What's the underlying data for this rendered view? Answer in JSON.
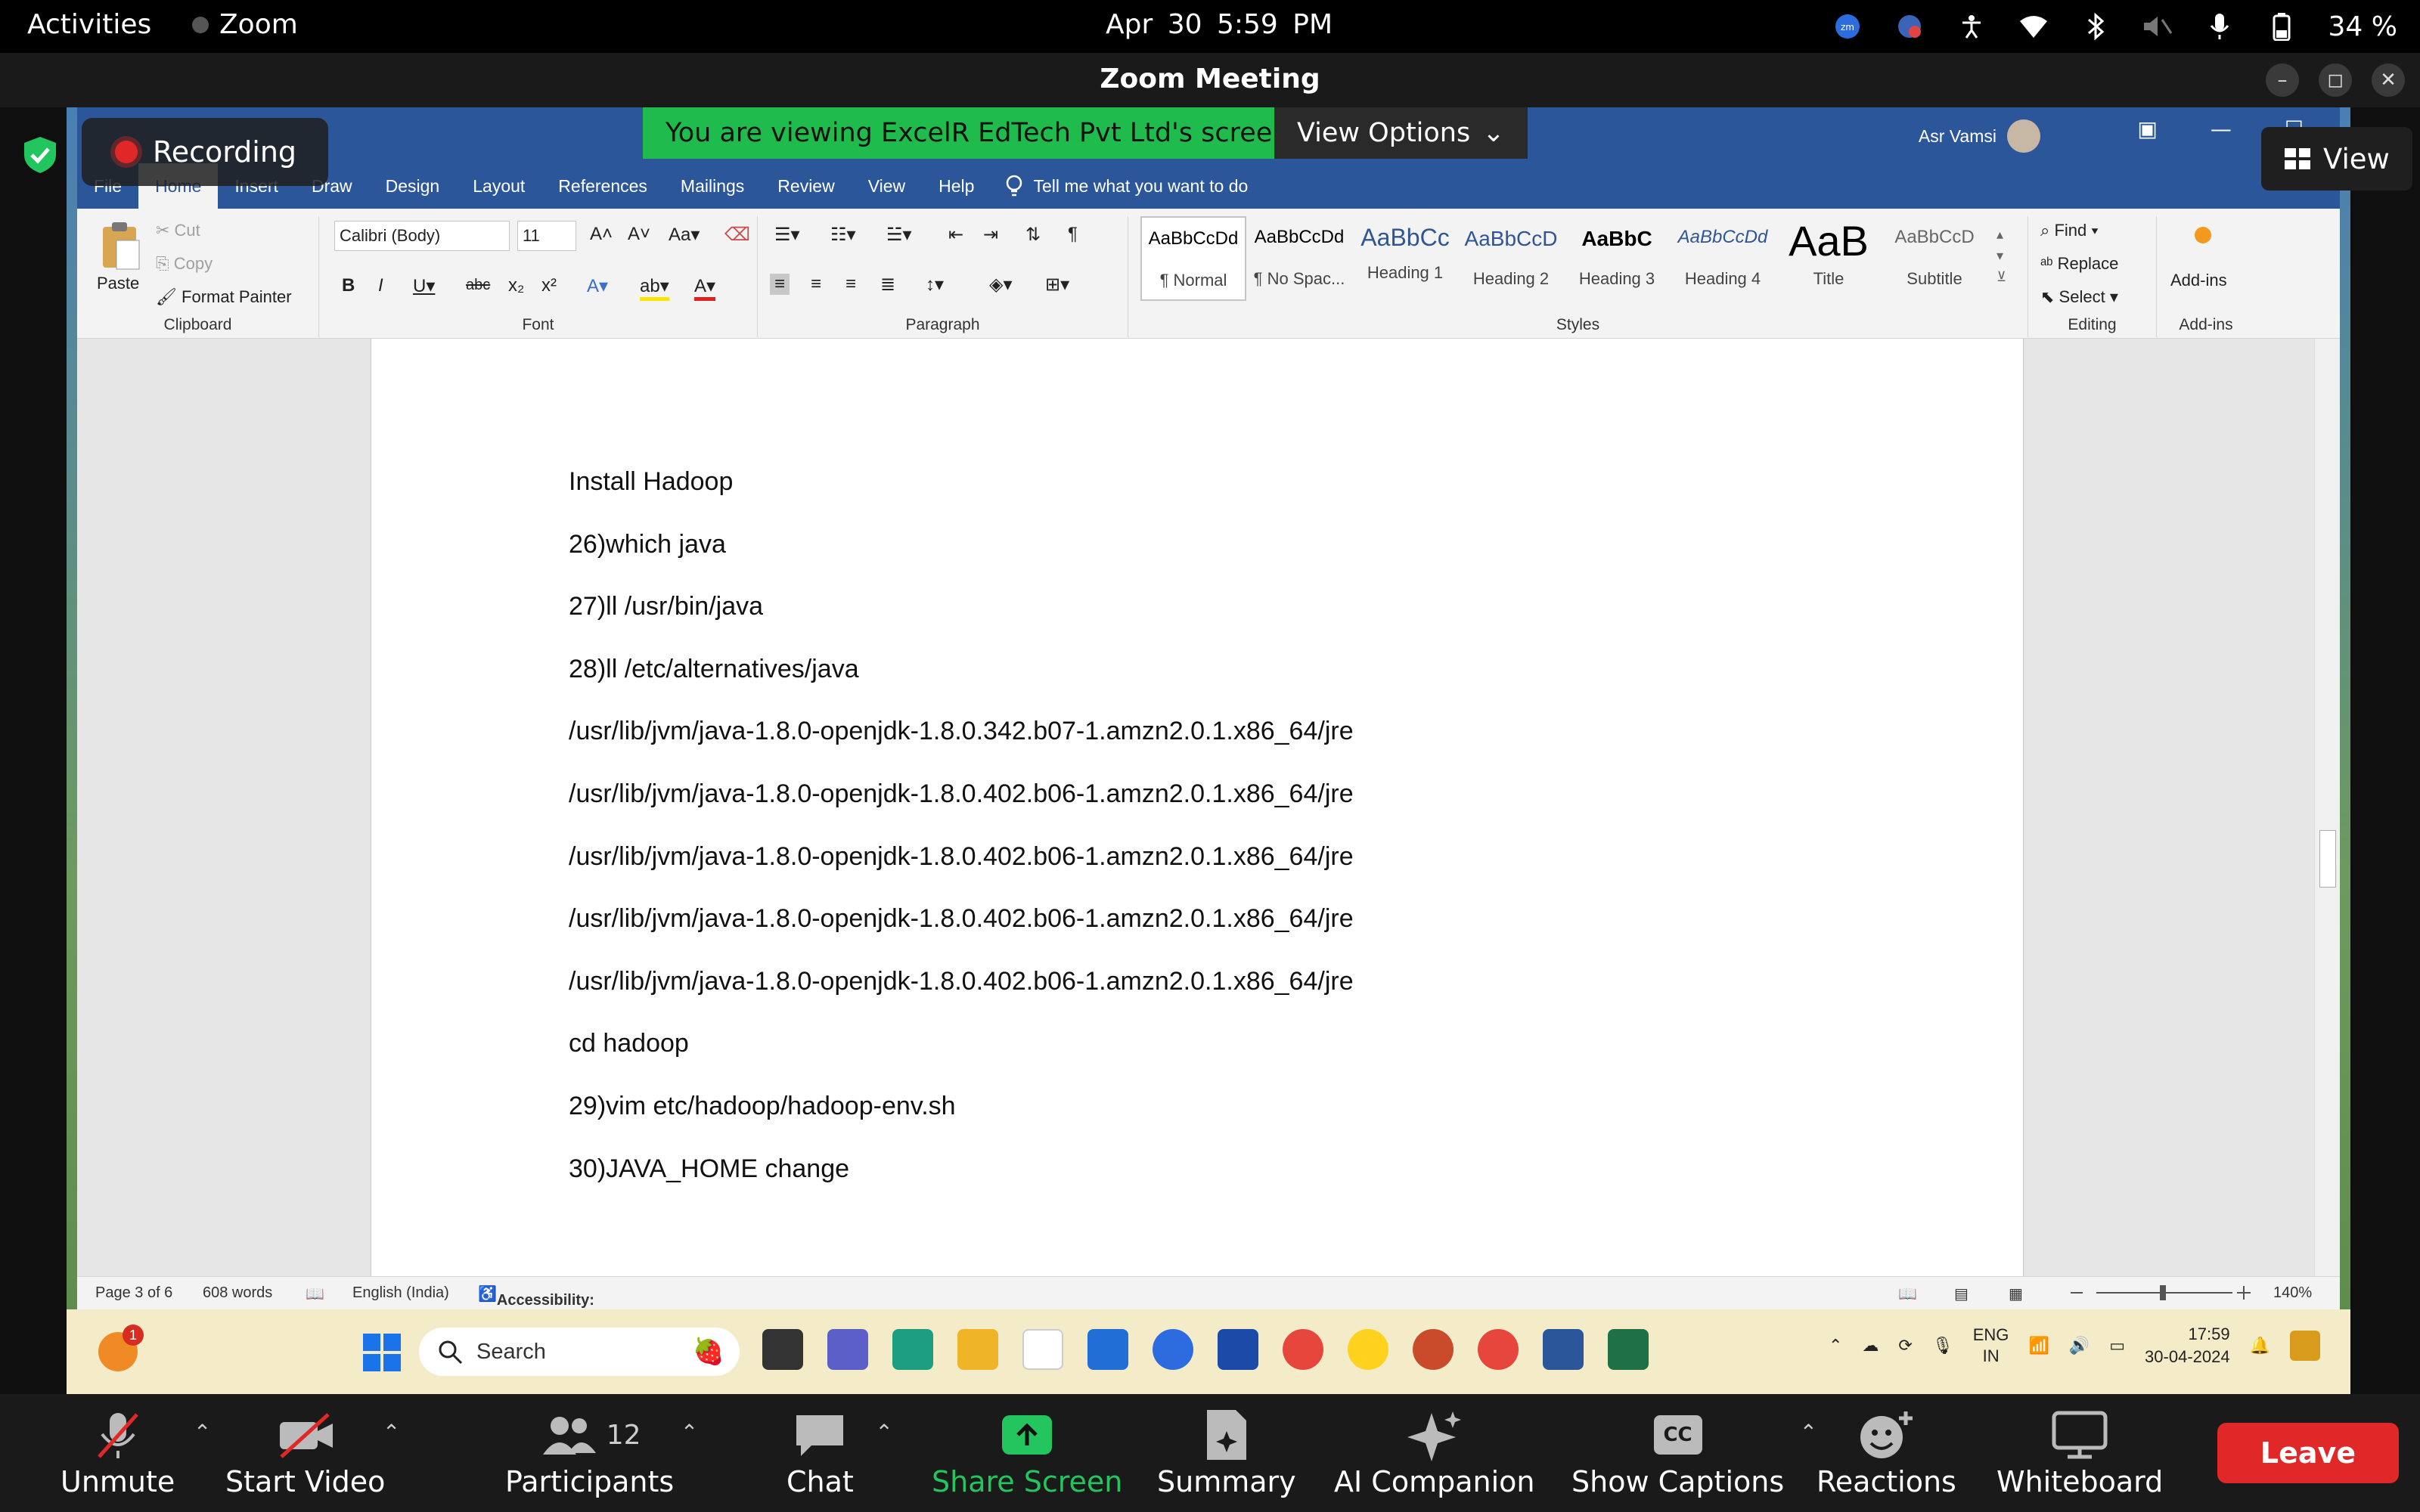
{
  "system_bar": {
    "activities": "Activities",
    "app_name": "Zoom",
    "datetime": "Apr 30  5:59 PM",
    "battery": "34 %"
  },
  "zoom_window": {
    "title": "Zoom Meeting"
  },
  "share": {
    "recording_label": "Recording",
    "viewing_banner": "You are viewing ExcelR EdTech Pvt Ltd's screen",
    "view_options_label": "View Options",
    "view_label": "View"
  },
  "word": {
    "user_name": "Asr Vamsi",
    "tabs": [
      "File",
      "Home",
      "Insert",
      "Draw",
      "Design",
      "Layout",
      "References",
      "Mailings",
      "Review",
      "View",
      "Help"
    ],
    "tell_me": "Tell me what you want to do",
    "clipboard": {
      "paste": "Paste",
      "cut": "Cut",
      "copy": "Copy",
      "format_painter": "Format Painter",
      "group": "Clipboard"
    },
    "font": {
      "name": "Calibri (Body)",
      "size": "11",
      "group": "Font"
    },
    "paragraph_group": "Paragraph",
    "styles": [
      {
        "sample": "AaBbCcDd",
        "name": "¶ Normal"
      },
      {
        "sample": "AaBbCcDd",
        "name": "¶ No Spac..."
      },
      {
        "sample": "AaBbCc",
        "name": "Heading 1"
      },
      {
        "sample": "AaBbCcD",
        "name": "Heading 2"
      },
      {
        "sample": "AaBbC",
        "name": "Heading 3"
      },
      {
        "sample": "AaBbCcDd",
        "name": "Heading 4"
      },
      {
        "sample": "AaB",
        "name": "Title"
      },
      {
        "sample": "AaBbCcD",
        "name": "Subtitle"
      }
    ],
    "styles_group": "Styles",
    "editing": {
      "find": "Find",
      "replace": "Replace",
      "select": "Select",
      "group": "Editing"
    },
    "addins": {
      "label": "Add-ins",
      "group": "Add-ins"
    },
    "document_lines": [
      "Install Hadoop",
      "26)which java",
      "27)ll  /usr/bin/java",
      "28)ll  /etc/alternatives/java",
      "/usr/lib/jvm/java-1.8.0-openjdk-1.8.0.342.b07-1.amzn2.0.1.x86_64/jre",
      "/usr/lib/jvm/java-1.8.0-openjdk-1.8.0.402.b06-1.amzn2.0.1.x86_64/jre",
      "/usr/lib/jvm/java-1.8.0-openjdk-1.8.0.402.b06-1.amzn2.0.1.x86_64/jre",
      "/usr/lib/jvm/java-1.8.0-openjdk-1.8.0.402.b06-1.amzn2.0.1.x86_64/jre",
      "/usr/lib/jvm/java-1.8.0-openjdk-1.8.0.402.b06-1.amzn2.0.1.x86_64/jre",
      "cd hadoop",
      "29)vim etc/hadoop/hadoop-env.sh",
      "30)JAVA_HOME change"
    ],
    "status": {
      "page": "Page 3 of 6",
      "words": "608 words",
      "language": "English (India)",
      "accessibility": "Accessibility: Investigate",
      "zoom": "140%"
    }
  },
  "taskbar": {
    "weather_badge": "1",
    "search_placeholder": "Search",
    "lang_line1": "ENG",
    "lang_line2": "IN",
    "time": "17:59",
    "date": "30-04-2024"
  },
  "zoom_controls": {
    "unmute": "Unmute",
    "start_video": "Start Video",
    "participants": "Participants",
    "participants_count": "12",
    "chat": "Chat",
    "share_screen": "Share Screen",
    "summary": "Summary",
    "ai_companion": "AI Companion",
    "show_captions": "Show Captions",
    "captions_badge": "CC",
    "reactions": "Reactions",
    "whiteboard": "Whiteboard",
    "leave": "Leave"
  },
  "colors": {
    "word_blue": "#2b579a",
    "zoom_green": "#22c55e",
    "leave_red": "#e02828",
    "banner_green": "#1fbb4d"
  }
}
